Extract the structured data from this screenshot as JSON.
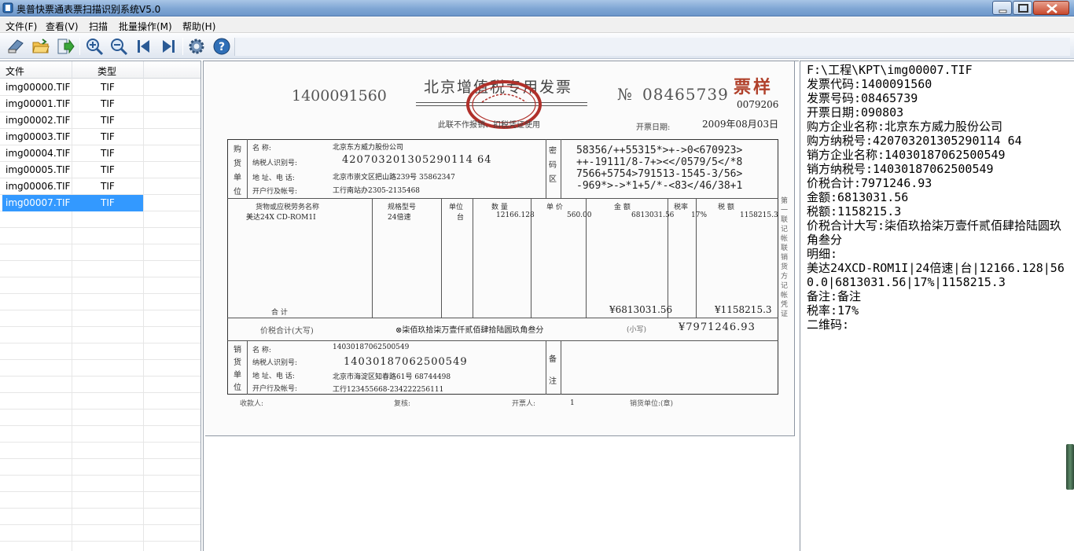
{
  "window": {
    "title": "奥普快票通表票扫描识别系统V5.0"
  },
  "menu": [
    "文件(F)",
    "查看(V)",
    "扫描",
    "批量操作(M)",
    "帮助(H)"
  ],
  "file_list": {
    "headers": [
      "文件",
      "类型"
    ],
    "rows": [
      {
        "name": "img00000.TIF",
        "type": "TIF"
      },
      {
        "name": "img00001.TIF",
        "type": "TIF"
      },
      {
        "name": "img00002.TIF",
        "type": "TIF"
      },
      {
        "name": "img00003.TIF",
        "type": "TIF"
      },
      {
        "name": "img00004.TIF",
        "type": "TIF"
      },
      {
        "name": "img00005.TIF",
        "type": "TIF"
      },
      {
        "name": "img00006.TIF",
        "type": "TIF"
      },
      {
        "name": "img00007.TIF",
        "type": "TIF"
      }
    ],
    "selected": "img00007.TIF"
  },
  "invoice": {
    "code": "1400091560",
    "title": "北京增值税专用发票",
    "no_symbol": "№",
    "number": "08465739",
    "stamp_text": "票样",
    "top_right_code": "0079206",
    "note": "此联不作报销、扣税凭证使用",
    "date_label": "开票日期:",
    "date": "2009年08月03日",
    "buyer_side": "购货单位",
    "buyer_labels": [
      "名 称:",
      "纳税人识别号:",
      "地 址、电 话:",
      "开户行及帐号:"
    ],
    "buyer_name": "北京东方威力股份公司",
    "buyer_tax_id": "420703201305290114 64",
    "buyer_address": "北京市崇文区把山路239号 35862347",
    "buyer_bank": "工行南站办2305-2135468",
    "cipher_side": "密码区",
    "cipher_lines": [
      "58356/++55315*>+->0<670923>",
      "++-19111/8-7+><</0579/5</*8",
      "7566+5754>791513-1545-3/56>",
      "-969*>->*1+5/*-<83</46/38+1"
    ],
    "item_headers": [
      "货物或应税劳务名称",
      "规格型号",
      "单位",
      "数 量",
      "单 价",
      "金 额",
      "税率",
      "税 额"
    ],
    "item": {
      "name": "美达24X CD-ROM1I",
      "spec": "24倍速",
      "unit": "台",
      "qty": "12166.128",
      "price": "560.00",
      "amount": "6813031.56",
      "rate": "17%",
      "tax": "1158215.3"
    },
    "total_label": "合  计",
    "total_amount": "¥6813031.56",
    "total_tax": "¥1158215.3",
    "sum_label": "价税合计(大写)",
    "sum_words": "⊗柒佰玖拾柒万壹仟贰佰肆拾陆圆玖角叁分",
    "sum_small_label": "(小写)",
    "sum_small": "¥7971246.93",
    "seller_side": "销货单位",
    "seller_labels": [
      "名 称:",
      "纳税人识别号:",
      "地 址、电 话:",
      "开户行及帐号:"
    ],
    "seller_name": "14030187062500549",
    "seller_tax_id": "14030187062500549",
    "seller_address": "北京市海淀区知春路61号 68744498",
    "seller_bank": "工行123455668-234222256111",
    "remark_side": "备注",
    "side_note": "第一联 记帐联 销货方记帐凭证",
    "footer": [
      "收款人:",
      "复核:",
      "开票人:",
      "1",
      "销货单位:(章)"
    ]
  },
  "ocr_result": [
    "F:\\工程\\KPT\\img00007.TIF",
    "发票代码:1400091560",
    "发票号码:08465739",
    "开票日期:090803",
    "购方企业名称:北京东方威力股份公司",
    "购方纳税号:420703201305290114 64",
    "销方企业名称:14030187062500549",
    "销方纳税号:14030187062500549",
    "价税合计:7971246.93",
    "金额:6813031.56",
    "税额:1158215.3",
    "价税合计大写:柒佰玖拾柒万壹仟贰佰肆拾陆圆玖角叁分",
    "明细:",
    "美达24XCD-ROM1I|24倍速|台|12166.128|560.0|6813031.56|17%|1158215.3",
    "备注:备注",
    "税率:17%",
    "二维码:"
  ]
}
